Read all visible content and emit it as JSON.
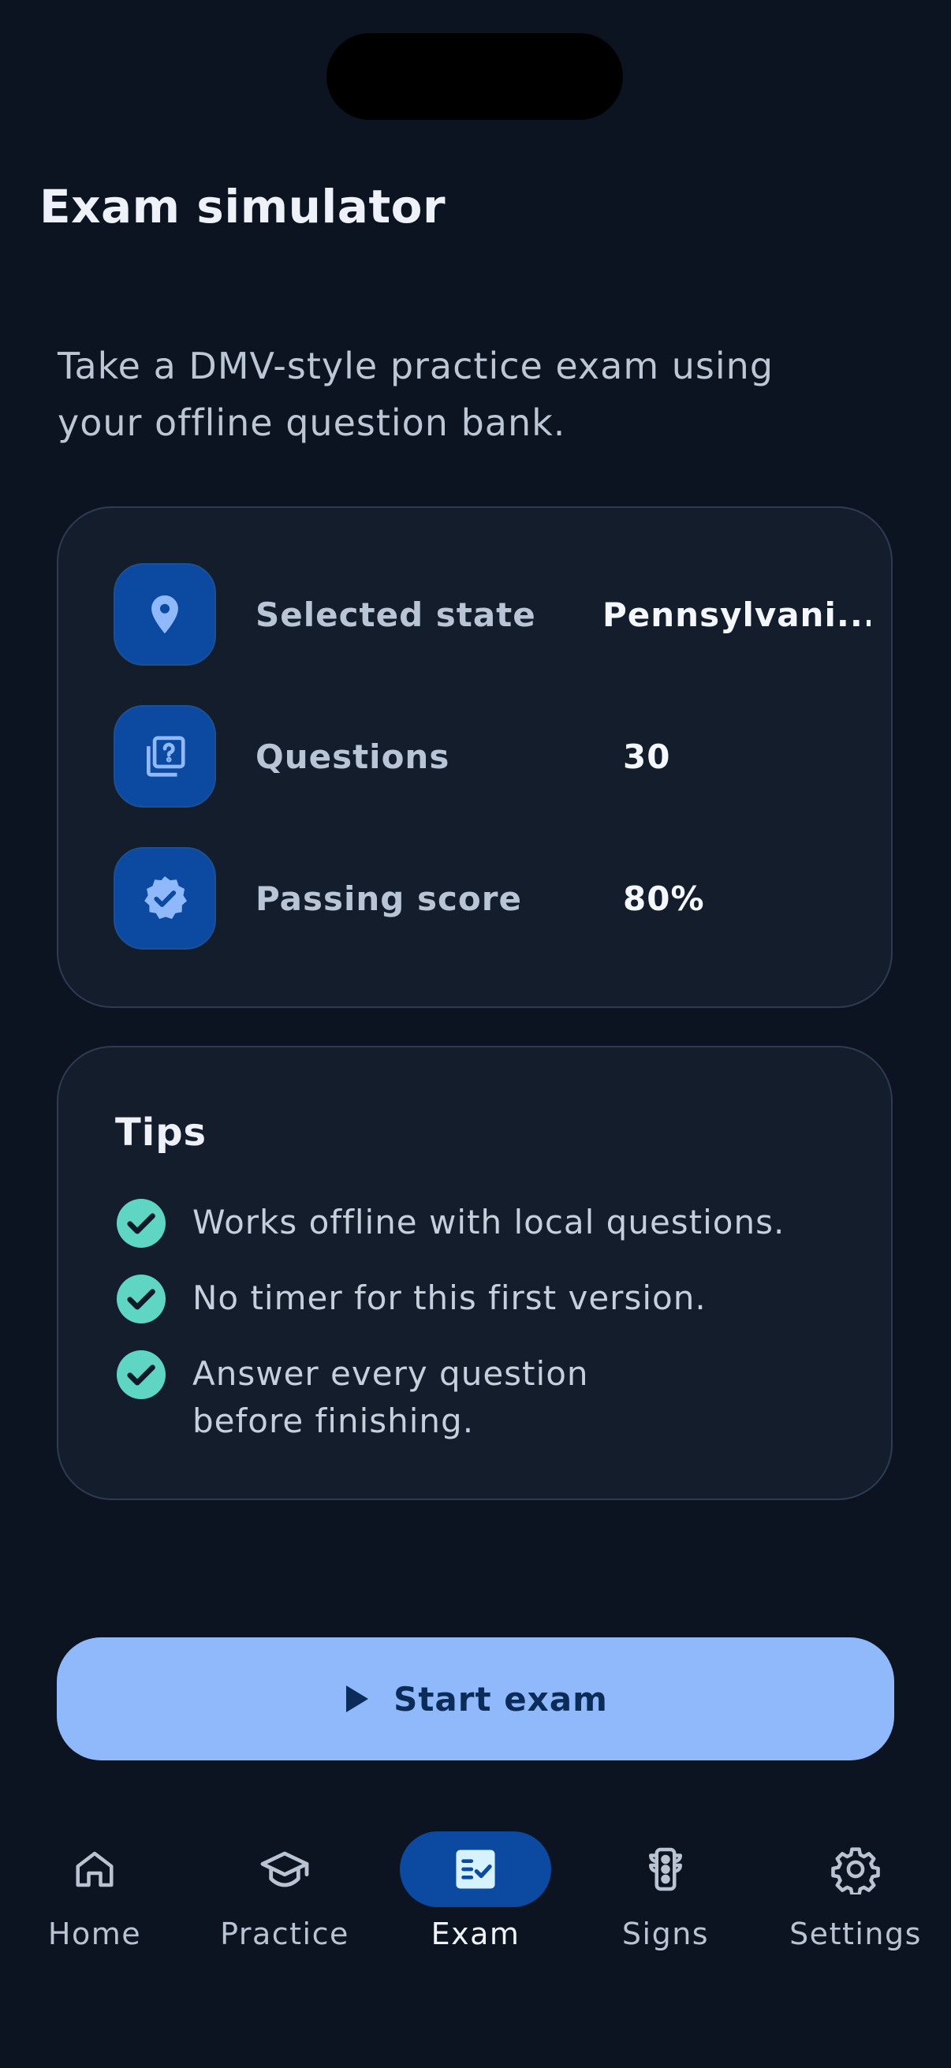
{
  "header": {
    "title": "Exam simulator"
  },
  "intro": {
    "text": "Take a DMV-style practice exam using your offline question bank."
  },
  "summary": {
    "rows": [
      {
        "icon": "location-pin-icon",
        "label": "Selected state",
        "value": "Pennsylvani..."
      },
      {
        "icon": "question-bank-icon",
        "label": "Questions",
        "value": "30"
      },
      {
        "icon": "verified-badge-icon",
        "label": "Passing score",
        "value": "80%"
      }
    ]
  },
  "tips": {
    "title": "Tips",
    "items": [
      "Works offline with local questions.",
      "No timer for this first version.",
      "Answer every question before finishing."
    ]
  },
  "start_button": {
    "icon": "play-icon",
    "label": "Start exam"
  },
  "nav": {
    "active": "Exam",
    "items": [
      {
        "label": "Home",
        "icon": "home-icon"
      },
      {
        "label": "Practice",
        "icon": "graduation-cap-icon"
      },
      {
        "label": "Exam",
        "icon": "exam-checklist-icon"
      },
      {
        "label": "Signs",
        "icon": "traffic-light-icon"
      },
      {
        "label": "Settings",
        "icon": "gear-icon"
      }
    ]
  },
  "colors": {
    "background": "#0c1421",
    "card": "#141d2c",
    "accent": "#0b4aa0",
    "button": "#8fb9fb",
    "check": "#5fd6c4"
  }
}
